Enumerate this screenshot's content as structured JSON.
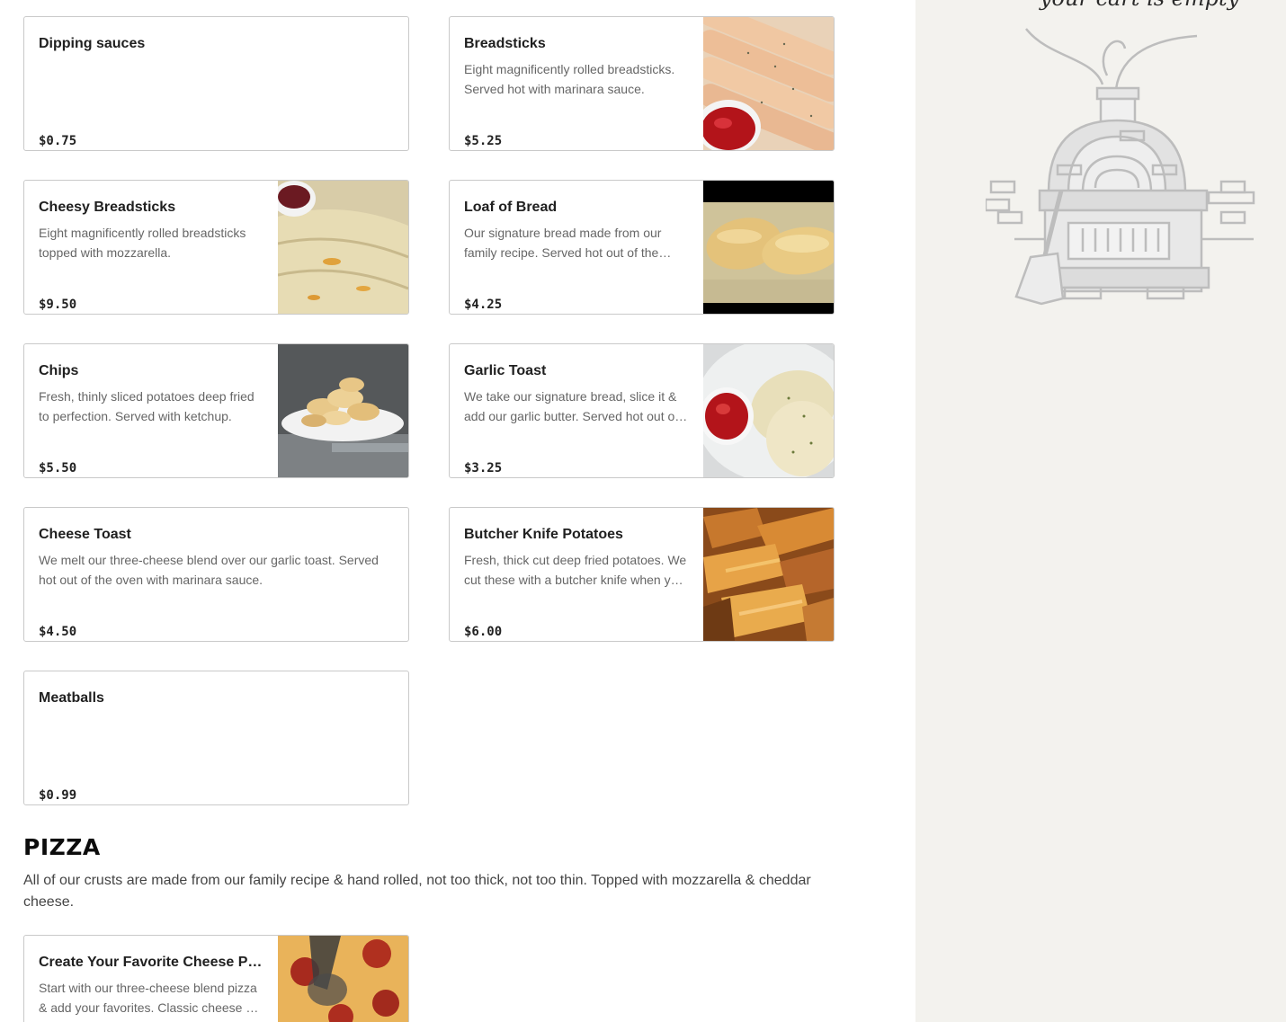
{
  "menu": {
    "items": [
      {
        "name": "Dipping sauces",
        "description": "",
        "price": "$0.75"
      },
      {
        "name": "Breadsticks",
        "description": "Eight magnificently rolled breadsticks. Served hot with marinara sauce.",
        "price": "$5.25"
      },
      {
        "name": "Cheesy Breadsticks",
        "description": "Eight magnificently rolled breadsticks topped with mozzarella.",
        "price": "$9.50"
      },
      {
        "name": "Loaf of Bread",
        "description": "Our signature bread made from our family recipe. Served hot out of the oven.",
        "price": "$4.25"
      },
      {
        "name": "Chips",
        "description": "Fresh, thinly sliced potatoes deep fried to perfection. Served with ketchup.",
        "price": "$5.50"
      },
      {
        "name": "Garlic Toast",
        "description": "We take our signature bread, slice it & add our garlic butter. Served hot out of the oven.",
        "price": "$3.25"
      },
      {
        "name": "Cheese Toast",
        "description": "We melt our three-cheese blend over our garlic toast. Served hot out of the oven with marinara sauce.",
        "price": "$4.50"
      },
      {
        "name": "Butcher Knife Potatoes",
        "description": "Fresh, thick cut deep fried potatoes. We cut these with a butcher knife when you order.",
        "price": "$6.00"
      },
      {
        "name": "Meatballs",
        "description": "",
        "price": "$0.99"
      },
      {
        "name": "Create Your Favorite Cheese Pizza",
        "description": "Start with our three-cheese blend pizza & add your favorites. Classic cheese or build your own.",
        "price": ""
      }
    ]
  },
  "pizza_section": {
    "title": "PIZZA",
    "description": "All of our crusts are made from our family recipe & hand rolled, not too thick, not too thin. Topped with mozzarella & cheddar cheese."
  },
  "cart": {
    "empty_text": "your cart is empty"
  }
}
